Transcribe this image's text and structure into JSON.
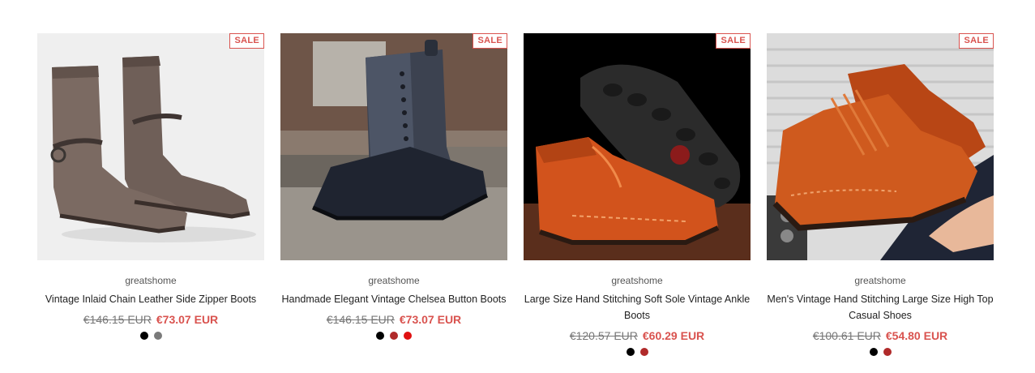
{
  "products": [
    {
      "vendor": "greatshome",
      "title": "Vintage Inlaid Chain Leather Side Zipper Boots",
      "badge": "SALE",
      "price_old": "€146.15 EUR",
      "price_new": "€73.07 EUR",
      "swatches": [
        "#000000",
        "#7a7a7a"
      ]
    },
    {
      "vendor": "greatshome",
      "title": "Handmade Elegant Vintage Chelsea Button Boots",
      "badge": "SALE",
      "price_old": "€146.15 EUR",
      "price_new": "€73.07 EUR",
      "swatches": [
        "#000000",
        "#b02a2a",
        "#e01010"
      ]
    },
    {
      "vendor": "greatshome",
      "title": "Large Size Hand Stitching Soft Sole Vintage Ankle Boots",
      "badge": "SALE",
      "price_old": "€120.57 EUR",
      "price_new": "€60.29 EUR",
      "swatches": [
        "#000000",
        "#b02a2a"
      ]
    },
    {
      "vendor": "greatshome",
      "title": "Men's Vintage Hand Stitching Large Size High Top Casual Shoes",
      "badge": "SALE",
      "price_old": "€100.61 EUR",
      "price_new": "€54.80 EUR",
      "swatches": [
        "#000000",
        "#b02a2a"
      ]
    }
  ],
  "colors": {
    "sale": "#d9534f"
  }
}
